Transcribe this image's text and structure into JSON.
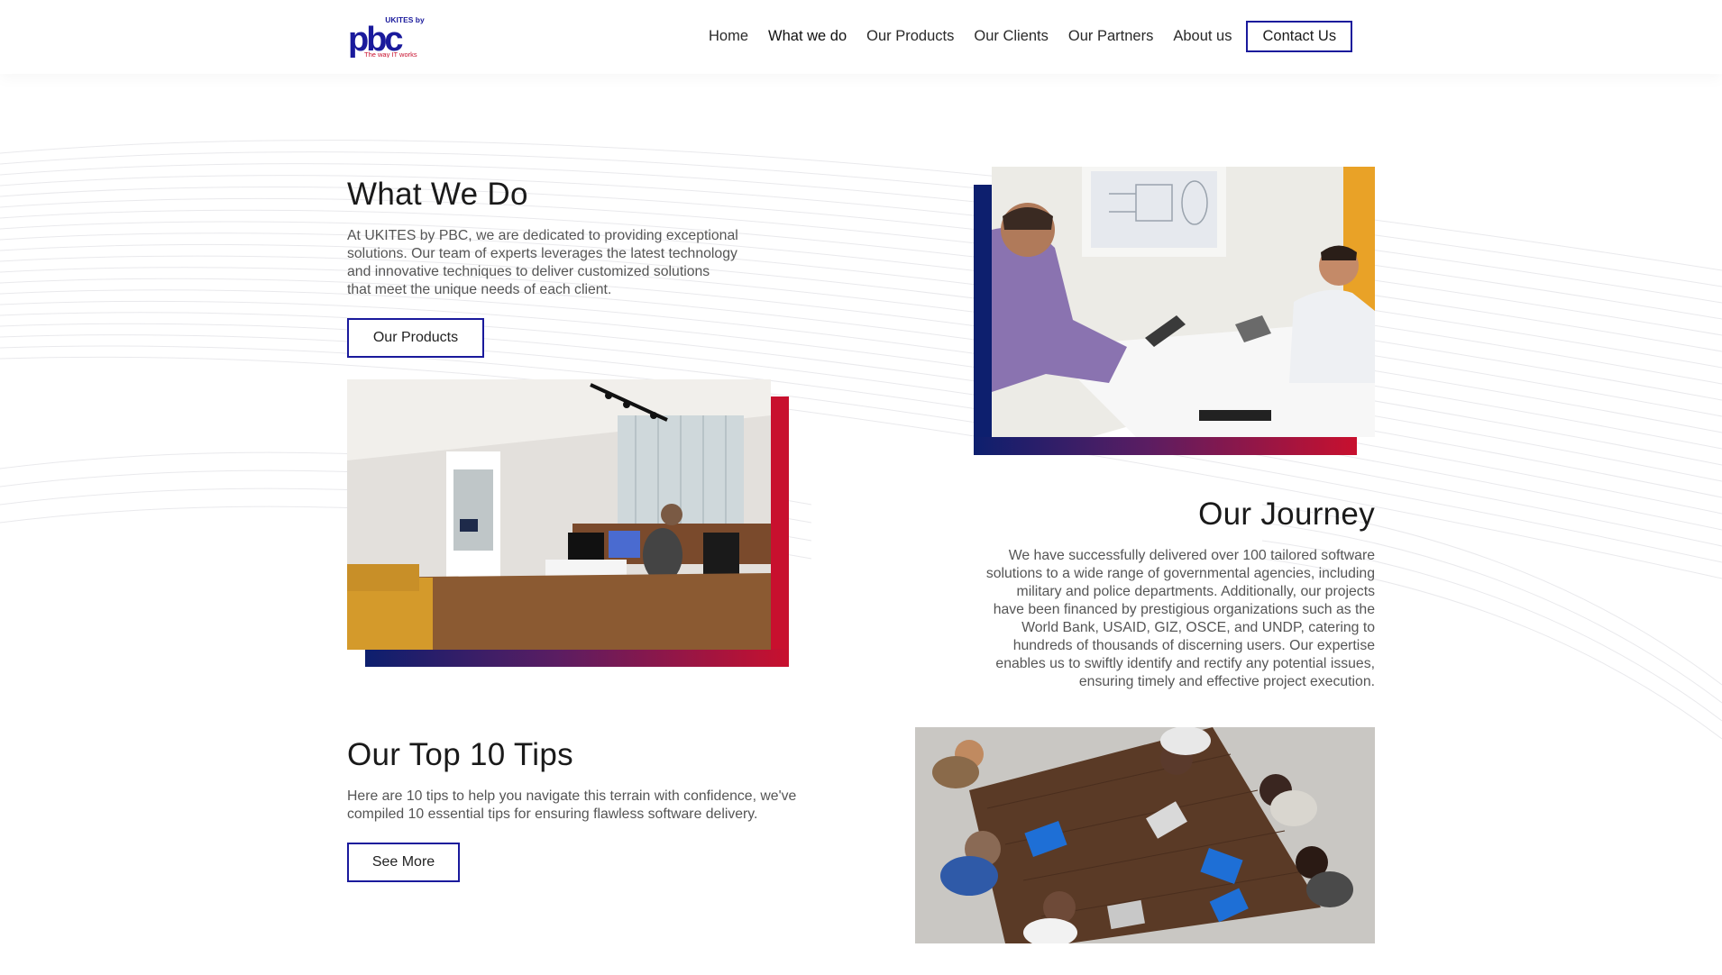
{
  "brand": {
    "logo_text": "pbc",
    "logo_top": "UKITES by",
    "logo_tagline": "The way IT works",
    "logo_color": "#1a1a9c",
    "accent_red": "#c8102e",
    "accent_navy": "#0d1f6e"
  },
  "nav": {
    "items": [
      {
        "label": "Home"
      },
      {
        "label": "What we do",
        "active": true
      },
      {
        "label": "Our Products"
      },
      {
        "label": "Our Clients"
      },
      {
        "label": "Our Partners"
      },
      {
        "label": "About us"
      }
    ],
    "contact_label": "Contact Us"
  },
  "what_we_do": {
    "title": "What We Do",
    "lines": [
      "At UKITES by PBC, we are dedicated to providing exceptional",
      "solutions. Our team of experts leverages the latest technology",
      "and innovative techniques to deliver customized solutions",
      "that meet the unique needs of each client."
    ],
    "button_label": "Our Products"
  },
  "journey": {
    "title": "Our Journey",
    "lines": [
      "We have successfully delivered over 100 tailored software",
      "solutions to a wide range of governmental agencies, including",
      "military and police departments. Additionally, our projects",
      "have been financed by prestigious organizations such as the",
      "World Bank, USAID, GIZ, OSCE, and UNDP, catering to",
      "hundreds of thousands of discerning users. Our expertise",
      "enables us to swiftly identify and rectify any potential issues,",
      "ensuring timely and effective project execution."
    ]
  },
  "tips": {
    "title": "Our Top 10 Tips",
    "lines": [
      "Here are 10 tips to help you navigate this terrain with confidence, we've",
      "compiled 10 essential tips for ensuring flawless software delivery."
    ],
    "button_label": "See More"
  }
}
